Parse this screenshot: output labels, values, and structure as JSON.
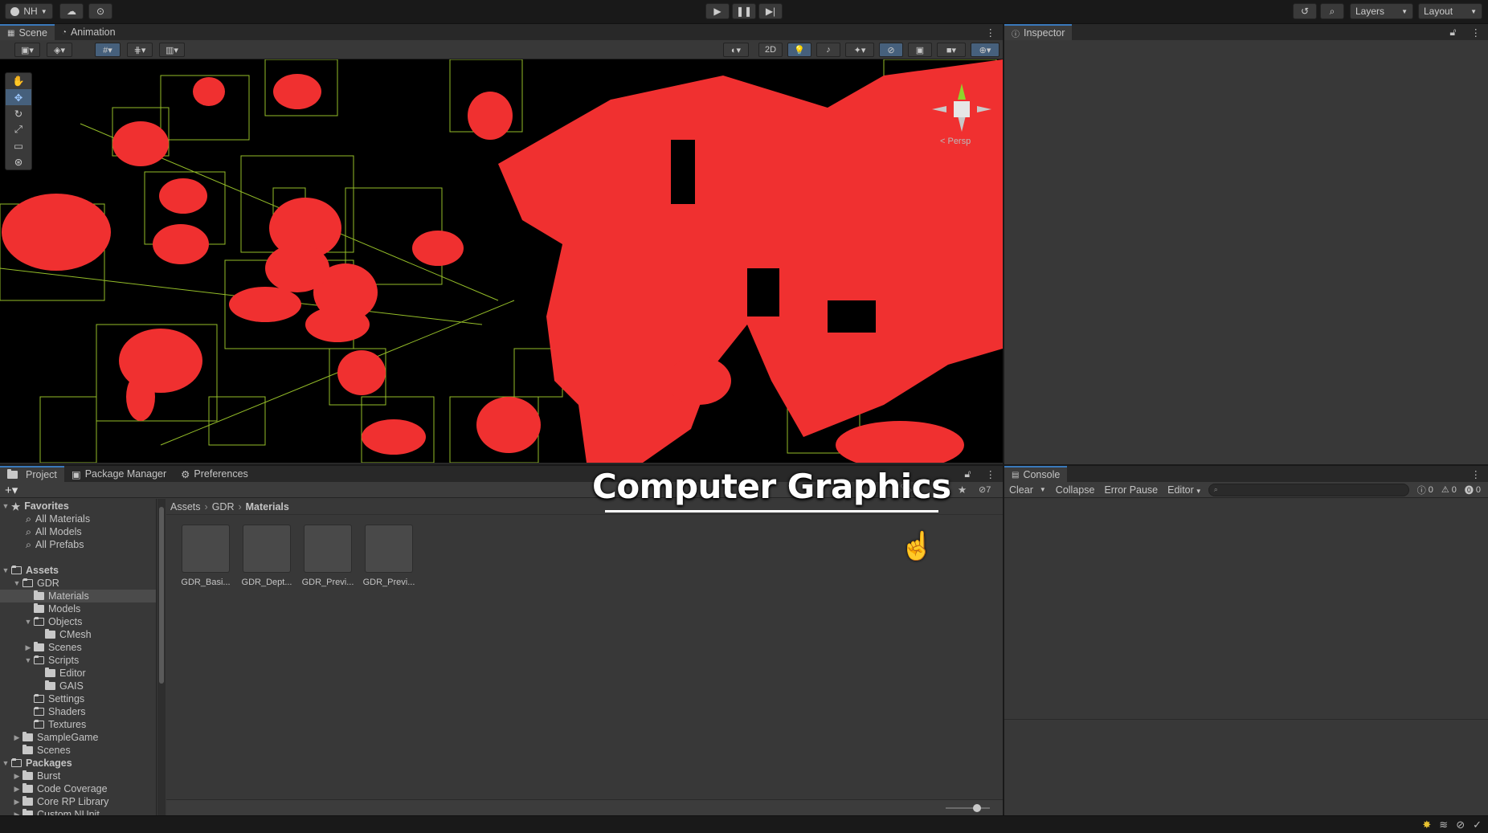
{
  "topbar": {
    "account_label": "NH",
    "layers_label": "Layers",
    "layout_label": "Layout"
  },
  "scene": {
    "tabs": [
      {
        "label": "Scene"
      },
      {
        "label": "Animation"
      }
    ],
    "toggle_2d": "2D",
    "gizmo_label": "< Persp"
  },
  "inspector": {
    "tab": "Inspector"
  },
  "project": {
    "tabs": [
      {
        "label": "Project"
      },
      {
        "label": "Package Manager"
      },
      {
        "label": "Preferences"
      }
    ],
    "breadcrumb": [
      "Assets",
      "GDR",
      "Materials"
    ],
    "hidden_count": "7",
    "favorites": {
      "label": "Favorites",
      "items": [
        "All Materials",
        "All Models",
        "All Prefabs"
      ]
    },
    "assets_label": "Assets",
    "tree": [
      {
        "label": "GDR"
      },
      {
        "label": "Materials"
      },
      {
        "label": "Models"
      },
      {
        "label": "Objects"
      },
      {
        "label": "CMesh"
      },
      {
        "label": "Scenes"
      },
      {
        "label": "Scripts"
      },
      {
        "label": "Editor"
      },
      {
        "label": "GAIS"
      },
      {
        "label": "Settings"
      },
      {
        "label": "Shaders"
      },
      {
        "label": "Textures"
      },
      {
        "label": "SampleGame"
      },
      {
        "label": "Scenes"
      }
    ],
    "packages_label": "Packages",
    "packages": [
      {
        "label": "Burst"
      },
      {
        "label": "Code Coverage"
      },
      {
        "label": "Core RP Library"
      },
      {
        "label": "Custom NUnit"
      }
    ],
    "assets": [
      {
        "label": "GDR_Basi..."
      },
      {
        "label": "GDR_Dept..."
      },
      {
        "label": "GDR_Previ..."
      },
      {
        "label": "GDR_Previ..."
      }
    ]
  },
  "console": {
    "tab": "Console",
    "clear": "Clear",
    "collapse": "Collapse",
    "error_pause": "Error Pause",
    "editor": "Editor",
    "log_count": "0",
    "warn_count": "0",
    "error_count": "0"
  },
  "overlay": {
    "title": "Computer Graphics"
  }
}
